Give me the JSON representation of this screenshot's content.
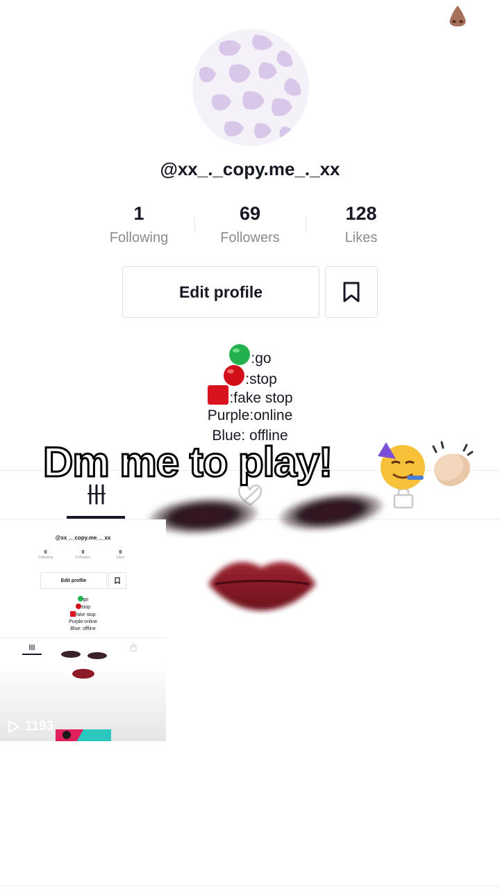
{
  "profile": {
    "username": "@xx_._copy.me_._xx",
    "stats": [
      {
        "value": "1",
        "label": "Following"
      },
      {
        "value": "69",
        "label": "Followers"
      },
      {
        "value": "128",
        "label": "Likes"
      }
    ],
    "edit_label": "Edit profile"
  },
  "bio": {
    "lines": [
      ":go",
      ":stop",
      ":fake stop",
      "Purple:online",
      "Blue: offline"
    ]
  },
  "overlay": {
    "caption": "Dm me to play!"
  },
  "thumbnail": {
    "username": "@xx_._copy.me_._xx",
    "stats": [
      {
        "value": "0",
        "label": "Following"
      },
      {
        "value": "0",
        "label": "Followers"
      },
      {
        "value": "0",
        "label": "Likes"
      }
    ],
    "edit_label": "Edit profile",
    "bio_lines": [
      "go",
      "stop",
      "fake stop",
      "Purple:online",
      "Blue: offline"
    ],
    "play_count": "1193"
  },
  "colors": {
    "avatar_bg": "#f3eef8",
    "avatar_spots": "#d9c8ea",
    "green": "#22b14c",
    "red": "#d10f1b",
    "text": "#161823",
    "muted": "#8a8b91"
  }
}
